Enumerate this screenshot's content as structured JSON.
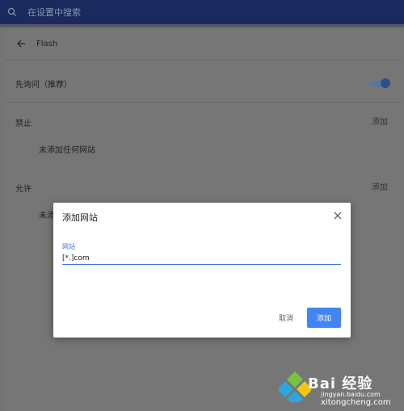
{
  "search": {
    "placeholder": "在设置中搜索"
  },
  "header": {
    "title": "Flash"
  },
  "ask_first": {
    "label": "先询问（推荐）",
    "enabled": true
  },
  "block": {
    "label": "禁止",
    "add_label": "添加",
    "empty_text": "未添加任何网站"
  },
  "allow": {
    "label": "允许",
    "add_label": "添加",
    "empty_text": "未添"
  },
  "dialog": {
    "title": "添加网站",
    "field_label": "网站",
    "field_value": "[*.]com",
    "cancel_label": "取消",
    "add_label": "添加"
  },
  "watermark": {
    "brand": "Bai 经验",
    "sub": "jingyan.baidu.com",
    "site": "xitongcheng.com"
  },
  "colors": {
    "accent": "#4285f4",
    "topbar": "#1a2a5e",
    "overlay": "#747474"
  }
}
